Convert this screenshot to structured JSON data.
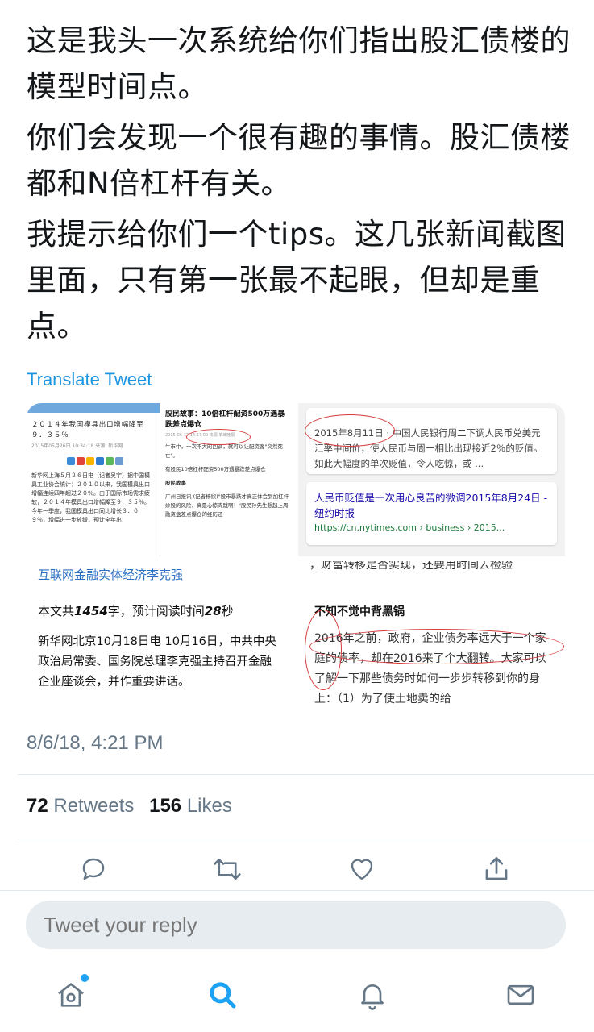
{
  "tweet": {
    "paragraphs": [
      "这是我头一次系统给你们指出股汇债楼的模型时间点。",
      "你们会发现一个很有趣的事情。股汇债楼都和N倍杠杆有关。",
      "我提示给你们一个tips。这几张新闻截图里面，只有第一张最不起眼，但却是重点。"
    ],
    "translate_label": "Translate Tweet",
    "timestamp": "8/6/18, 4:21 PM"
  },
  "media": {
    "tile1": {
      "left_headline": "２０１４年我国模具出口增幅降至９．３５％",
      "left_meta": "2015年05月26日 10:34:18 来源: 新华网",
      "left_body": "新华网上海５月２６日电（记者吴宇）据中国模具工业协会统计：２０１０以来，我国模具出口增幅连续四年超过２０％。由于国际市场需求疲软，２０１４年模具出口增幅降至９．３５％。今年一季度，我国模具出口同比增长３．０９％，增幅进一步放缓，预计全年出",
      "right_headline": "股民故事：10倍杠杆配资500万遇暴跌差点爆仓",
      "right_meta": "2015-06-17 14:17:00 来源 羊城晚报",
      "right_body_1": "牛市中，一次不大的回调，就可以让配资客\"突然死亡\"。",
      "right_body_2": "有股民10倍杠杆配资500万遇暴跌差点爆仓",
      "right_section": "股民故事",
      "right_body_3": "广州日报讯 (记者杨欣)\"股市暴跌才真正体会到加杠杆炒股的风险，真是心惊肉跳啊！\"股民孙先生想起上周融资盘差点爆仓的经历还"
    },
    "tile2": {
      "card1_text": "2015年8月11日 · 中国人民银行周二下调人民币兑美元汇率中间价，使人民币与周一相比出现接近2％的贬值。如此大幅度的单次贬值，令人吃惊，或 ...",
      "card2_link": "人民币贬值是一次用心良苦的微调2015年8月24日 - 纽约时报",
      "card2_url": "https://cn.nytimes.com › business › 2015..."
    },
    "tile3": {
      "title": "互联网金融实体经济李克强",
      "read_prefix": "本文共",
      "read_chars": "1454",
      "read_mid": "字，预计阅读时间",
      "read_secs": "28",
      "read_suffix": "秒",
      "body": "新华网北京10月18日电 10月16日，中共中央政治局常委、国务院总理李克强主持召开金融企业座谈会，并作重要讲话。"
    },
    "tile4": {
      "top_text": "，财富转移是否实现，还要用时间去检验",
      "subheading": "不知不觉中背黑锅",
      "body": "2016年之前，政府，企业债务率远大于一个家庭的债率，却在2016来了个大翻转。大家可以了解一下那些债务时如何一步步转移到你的身上：（1）为了使土地卖的给"
    }
  },
  "stats": {
    "retweets_count": "72",
    "retweets_label": "Retweets",
    "likes_count": "156",
    "likes_label": "Likes"
  },
  "reply": {
    "placeholder": "Tweet your reply"
  },
  "colors": {
    "accent": "#1da1f2",
    "link": "#1b95e0",
    "secondary": "#657786",
    "annotation_red": "#d63b3b"
  }
}
